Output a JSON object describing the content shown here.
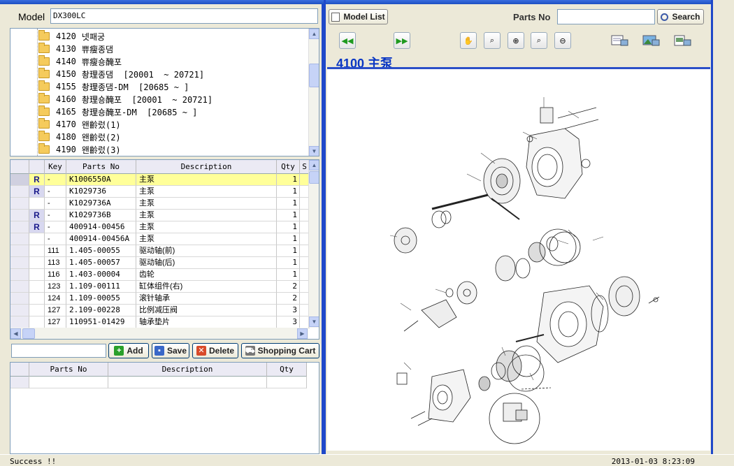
{
  "model": {
    "label": "Model",
    "value": "DX300LC"
  },
  "tree": [
    {
      "code": "4120",
      "name": "넷패궁"
    },
    {
      "code": "4130",
      "name": "쀼瘦종댐"
    },
    {
      "code": "4140",
      "name": "쀼瘦숑醃포"
    },
    {
      "code": "4150",
      "name": "촹理종댐  [20001  ~ 20721]"
    },
    {
      "code": "4155",
      "name": "촹理종댐-DM  [20685 ~ ]"
    },
    {
      "code": "4160",
      "name": "촹理숑醃포  [20001  ~ 20721]"
    },
    {
      "code": "4165",
      "name": "촹理숑醃포-DM  [20685 ~ ]"
    },
    {
      "code": "4170",
      "name": "왠齡렀(1)"
    },
    {
      "code": "4180",
      "name": "왠齡렀(2)"
    },
    {
      "code": "4190",
      "name": "왠齡렀(3)"
    }
  ],
  "parts_table": {
    "headers": {
      "key": "Key",
      "parts_no": "Parts No",
      "description": "Description",
      "qty": "Qty",
      "s": "S"
    },
    "rows": [
      {
        "badge": "R",
        "key": "-",
        "parts_no": "K1006550A",
        "description": "主泵",
        "qty": "1",
        "selected": true
      },
      {
        "badge": "R",
        "key": "-",
        "parts_no": "K1029736",
        "description": "主泵",
        "qty": "1"
      },
      {
        "badge": "",
        "key": "-",
        "parts_no": "K1029736A",
        "description": "主泵",
        "qty": "1"
      },
      {
        "badge": "R",
        "key": "-",
        "parts_no": "K1029736B",
        "description": "主泵",
        "qty": "1"
      },
      {
        "badge": "R",
        "key": "-",
        "parts_no": "400914-00456",
        "description": "主泵",
        "qty": "1"
      },
      {
        "badge": "",
        "key": "-",
        "parts_no": "400914-00456A",
        "description": "主泵",
        "qty": "1"
      },
      {
        "badge": "",
        "key": "111",
        "parts_no": "1.405-00055",
        "description": "驱动轴(前)",
        "qty": "1"
      },
      {
        "badge": "",
        "key": "113",
        "parts_no": "1.405-00057",
        "description": "驱动轴(后)",
        "qty": "1"
      },
      {
        "badge": "",
        "key": "116",
        "parts_no": "1.403-00004",
        "description": "齿轮",
        "qty": "1"
      },
      {
        "badge": "",
        "key": "123",
        "parts_no": "1.109-00111",
        "description": "缸体组件(右)",
        "qty": "2"
      },
      {
        "badge": "",
        "key": "124",
        "parts_no": "1.109-00055",
        "description": "滚针轴承",
        "qty": "2"
      },
      {
        "badge": "",
        "key": "127",
        "parts_no": "2.109-00228",
        "description": "比例减压阀",
        "qty": "3"
      },
      {
        "badge": "",
        "key": "127",
        "parts_no": "110951-01429",
        "description": "轴承垫片",
        "qty": "3"
      }
    ]
  },
  "actions": {
    "add": "Add",
    "save": "Save",
    "delete": "Delete",
    "cart": "Shopping Cart"
  },
  "cart_table": {
    "headers": {
      "parts_no": "Parts No",
      "description": "Description",
      "qty": "Qty"
    }
  },
  "status": {
    "text": "Success !!",
    "time": "2013-01-03 8:23:09"
  },
  "toolbar": {
    "model_list": "Model List",
    "parts_no_label": "Parts No",
    "search": "Search"
  },
  "diagram": {
    "title": "4100 主泵"
  }
}
